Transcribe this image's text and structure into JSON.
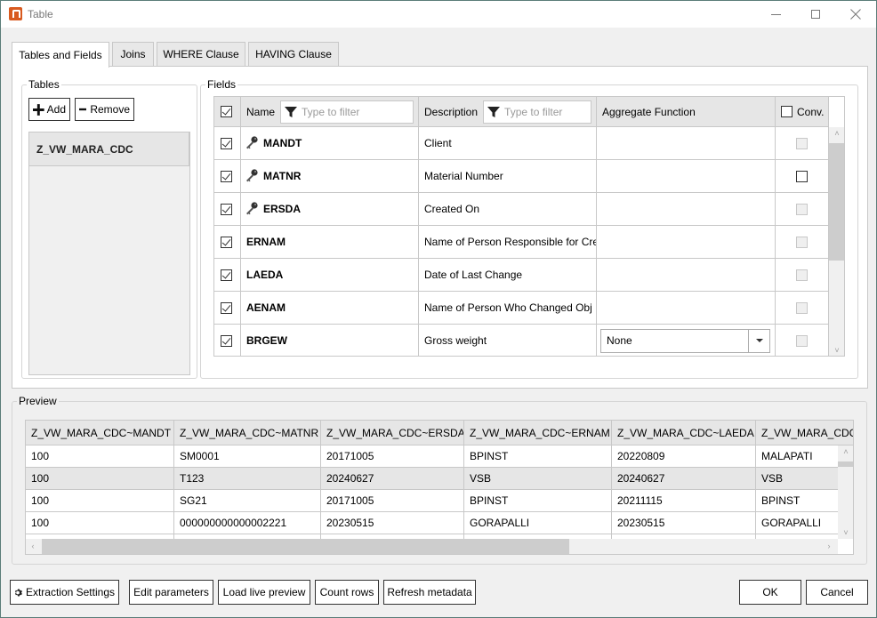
{
  "window": {
    "title": "Table",
    "controls": {
      "minimize": "minimize",
      "maximize": "maximize",
      "close": "close"
    }
  },
  "tabs": [
    {
      "label": "Tables and Fields",
      "active": true
    },
    {
      "label": "Joins",
      "active": false
    },
    {
      "label": "WHERE Clause",
      "active": false
    },
    {
      "label": "HAVING Clause",
      "active": false
    }
  ],
  "tables": {
    "legend": "Tables",
    "add_label": "Add",
    "remove_label": "Remove",
    "items": [
      "Z_VW_MARA_CDC"
    ]
  },
  "fields": {
    "legend": "Fields",
    "columns": {
      "name": "Name",
      "name_filter_placeholder": "Type to filter",
      "description": "Description",
      "description_filter_placeholder": "Type to filter",
      "aggregate": "Aggregate Function",
      "conv": "Conv."
    },
    "header_checked": true,
    "header_conv_checked": false,
    "rows": [
      {
        "checked": true,
        "key": true,
        "name": "MANDT",
        "description": "Client",
        "aggregate": "",
        "conv_enabled": false,
        "conv_checked": false
      },
      {
        "checked": true,
        "key": true,
        "name": "MATNR",
        "description": "Material Number",
        "aggregate": "",
        "conv_enabled": true,
        "conv_checked": false
      },
      {
        "checked": true,
        "key": true,
        "name": "ERSDA",
        "description": "Created On",
        "aggregate": "",
        "conv_enabled": false,
        "conv_checked": false
      },
      {
        "checked": true,
        "key": false,
        "name": "ERNAM",
        "description": "Name of Person Responsible for Cre",
        "aggregate": "",
        "conv_enabled": false,
        "conv_checked": false
      },
      {
        "checked": true,
        "key": false,
        "name": "LAEDA",
        "description": "Date of Last Change",
        "aggregate": "",
        "conv_enabled": false,
        "conv_checked": false
      },
      {
        "checked": true,
        "key": false,
        "name": "AENAM",
        "description": "Name of Person Who Changed Obj",
        "aggregate": "",
        "conv_enabled": false,
        "conv_checked": false
      },
      {
        "checked": true,
        "key": false,
        "name": "BRGEW",
        "description": "Gross weight",
        "aggregate": "None",
        "conv_enabled": false,
        "conv_checked": false
      }
    ]
  },
  "preview": {
    "legend": "Preview",
    "columns": [
      "Z_VW_MARA_CDC~MANDT",
      "Z_VW_MARA_CDC~MATNR",
      "Z_VW_MARA_CDC~ERSDA",
      "Z_VW_MARA_CDC~ERNAM",
      "Z_VW_MARA_CDC~LAEDA",
      "Z_VW_MARA_CDC~AENAM"
    ],
    "rows": [
      [
        "100",
        "SM0001",
        "20171005",
        "BPINST",
        "20220809",
        "MALAPATI"
      ],
      [
        "100",
        "T123",
        "20240627",
        "VSB",
        "20240627",
        "VSB"
      ],
      [
        "100",
        "SG21",
        "20171005",
        "BPINST",
        "20211115",
        "BPINST"
      ],
      [
        "100",
        "000000000000002221",
        "20230515",
        "GORAPALLI",
        "20230515",
        "GORAPALLI"
      ]
    ]
  },
  "footer": {
    "extraction_settings": "Extraction Settings",
    "edit_parameters": "Edit parameters",
    "load_live_preview": "Load live preview",
    "count_rows": "Count rows",
    "refresh_metadata": "Refresh metadata",
    "ok": "OK",
    "cancel": "Cancel"
  }
}
